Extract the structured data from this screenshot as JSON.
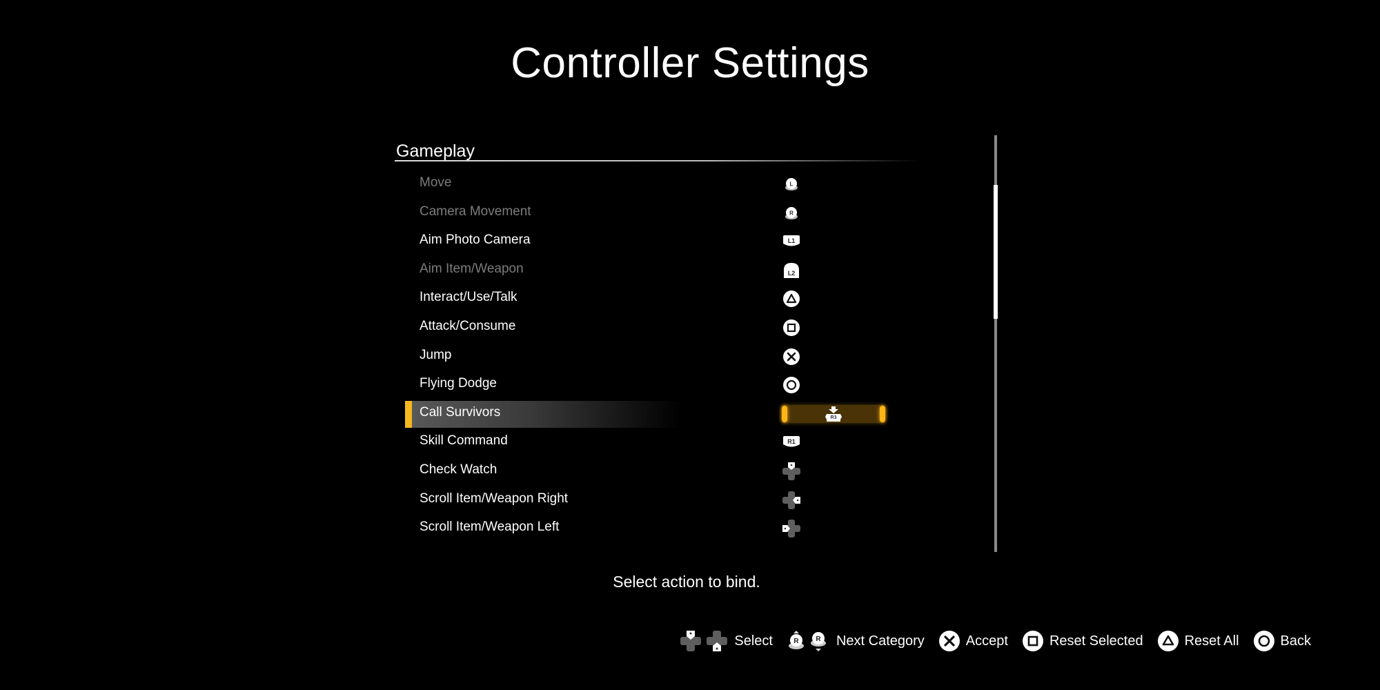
{
  "title": "Controller Settings",
  "section": {
    "header": "Gameplay"
  },
  "bindings": [
    {
      "label": "Move",
      "binding": "L stick",
      "icon": "left-stick-icon",
      "glyph": "L",
      "state": "disabled"
    },
    {
      "label": "Camera Movement",
      "binding": "R stick",
      "icon": "right-stick-icon",
      "glyph": "R",
      "state": "disabled"
    },
    {
      "label": "Aim Photo Camera",
      "binding": "L1",
      "icon": "l1-button-icon",
      "glyph": "L1",
      "state": "normal"
    },
    {
      "label": "Aim Item/Weapon",
      "binding": "L2",
      "icon": "l2-button-icon",
      "glyph": "L2",
      "state": "disabled"
    },
    {
      "label": "Interact/Use/Talk",
      "binding": "Triangle",
      "icon": "triangle-button-icon",
      "glyph": "triangle",
      "state": "normal"
    },
    {
      "label": "Attack/Consume",
      "binding": "Square",
      "icon": "square-button-icon",
      "glyph": "square",
      "state": "normal"
    },
    {
      "label": "Jump",
      "binding": "Cross",
      "icon": "cross-button-icon",
      "glyph": "cross",
      "state": "normal"
    },
    {
      "label": "Flying Dodge",
      "binding": "Circle",
      "icon": "circle-button-icon",
      "glyph": "circle",
      "state": "normal"
    },
    {
      "label": "Call Survivors",
      "binding": "R3",
      "icon": "r3-button-icon",
      "glyph": "R3",
      "state": "selected"
    },
    {
      "label": "Skill Command",
      "binding": "R1",
      "icon": "r1-button-icon",
      "glyph": "R1",
      "state": "normal"
    },
    {
      "label": "Check Watch",
      "binding": "D-pad Up",
      "icon": "dpad-up-icon",
      "glyph": "up",
      "state": "normal"
    },
    {
      "label": "Scroll Item/Weapon Right",
      "binding": "D-pad Right",
      "icon": "dpad-right-icon",
      "glyph": "right",
      "state": "normal"
    },
    {
      "label": "Scroll Item/Weapon Left",
      "binding": "D-pad Left",
      "icon": "dpad-left-icon",
      "glyph": "left",
      "state": "normal"
    }
  ],
  "scroll": {
    "position_fraction": 0.12,
    "visible_fraction": 0.32
  },
  "hint": "Select action to bind.",
  "footer": {
    "select": "Select",
    "next_category": "Next Category",
    "accept": "Accept",
    "reset_selected": "Reset Selected",
    "reset_all": "Reset All",
    "back": "Back"
  },
  "colors": {
    "accent": "#f7b81e",
    "disabled_text": "#7c7c7c",
    "binding_box": "#4a3306"
  }
}
